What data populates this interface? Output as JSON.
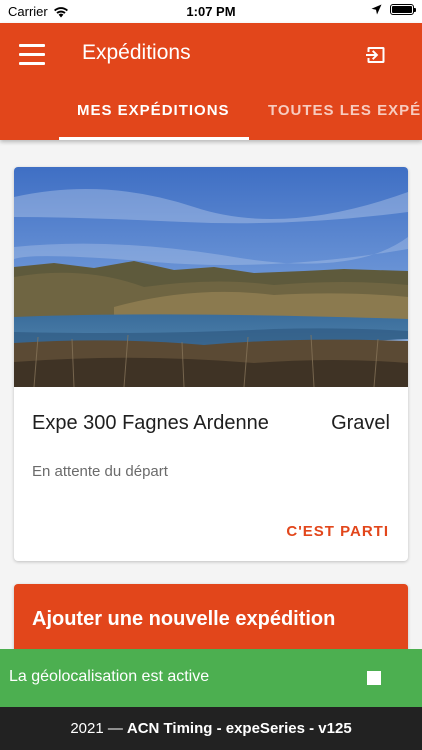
{
  "status_bar": {
    "carrier": "Carrier",
    "time": "1:07 PM"
  },
  "app_bar": {
    "title": "Expéditions",
    "tabs": [
      {
        "label": "MES EXPÉDITIONS",
        "active": true
      },
      {
        "label": "TOUTES LES EXPÉDITIONS",
        "active": false
      }
    ]
  },
  "expedition": {
    "title": "Expe 300 Fagnes Ardenne",
    "category": "Gravel",
    "status": "En attente du départ",
    "action_label": "C'EST PARTI"
  },
  "add_expedition": {
    "label": "Ajouter une nouvelle expédition"
  },
  "geolocation": {
    "text": "La géolocalisation est active"
  },
  "footer": {
    "year": "2021 —",
    "app": "ACN Timing - expeSeries - v125"
  },
  "colors": {
    "accent": "#e2461b",
    "geo_active": "#4caf50",
    "footer_bg": "#222222"
  }
}
